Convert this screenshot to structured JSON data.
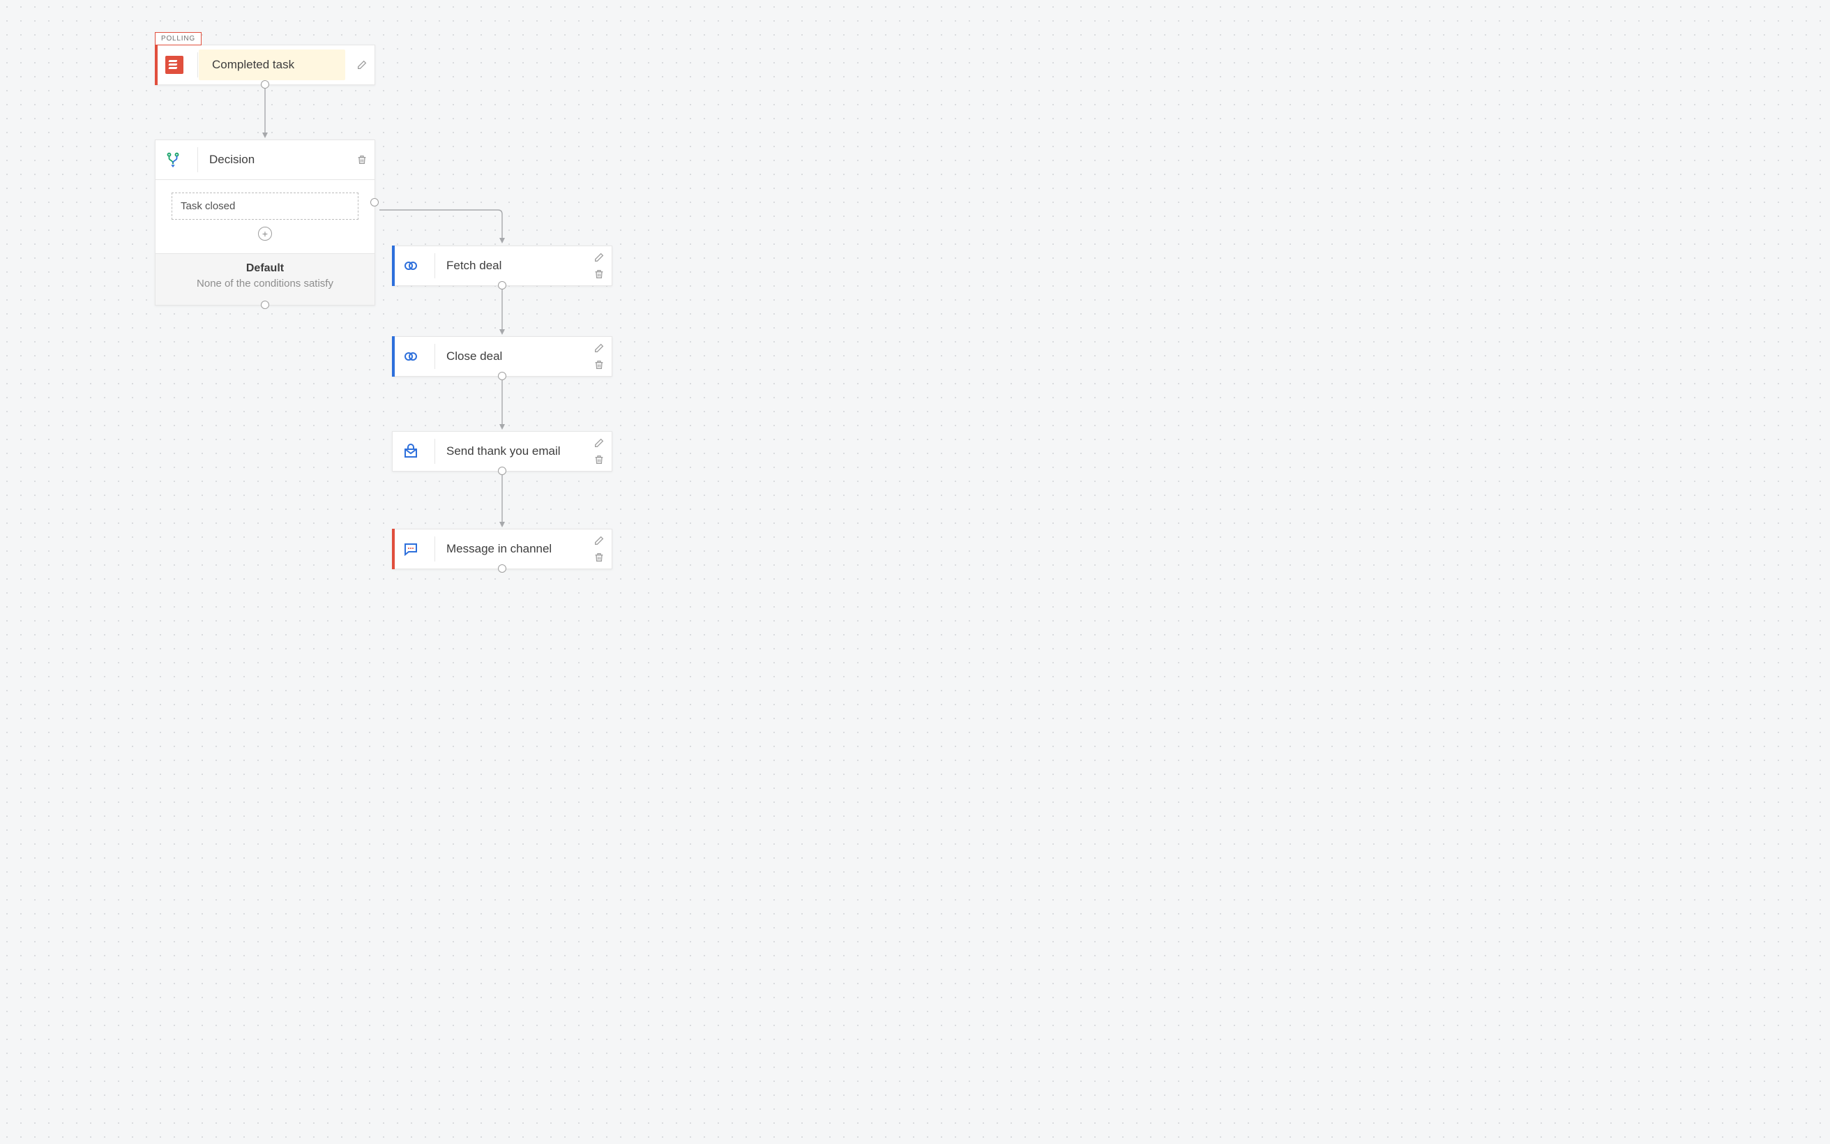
{
  "trigger": {
    "tag": "POLLING",
    "title": "Completed task",
    "icon": "todoist-icon",
    "accent": "#e04f3d"
  },
  "decision": {
    "title": "Decision",
    "icon": "branch-icon",
    "branch_label": "Task closed",
    "default_title": "Default",
    "default_subtitle": "None of the conditions satisfy"
  },
  "actions": [
    {
      "id": "fetch",
      "title": "Fetch deal",
      "icon": "link-icon",
      "accent": "#2d6fdb"
    },
    {
      "id": "close",
      "title": "Close deal",
      "icon": "link-icon",
      "accent": "#2d6fdb"
    },
    {
      "id": "thank",
      "title": "Send thank you email",
      "icon": "mail-icon",
      "accent": "#ffffff"
    },
    {
      "id": "message",
      "title": "Message in channel",
      "icon": "chat-icon",
      "accent": "#e04f3d"
    }
  ]
}
